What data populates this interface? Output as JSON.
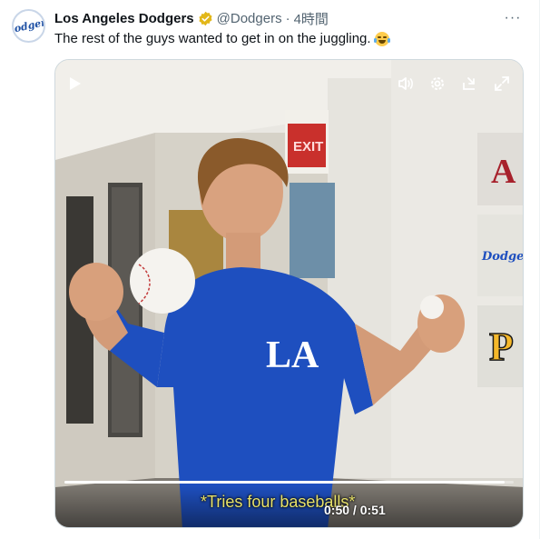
{
  "tweet": {
    "account_name": "Los Angeles Dodgers",
    "handle": "@Dodgers",
    "separator": "·",
    "time": "4時間",
    "more_label": "···",
    "text": "The rest of the guys wanted to get in on the juggling.",
    "emoji": "face-with-tears-of-joy",
    "avatar_text": "Dodgers"
  },
  "video": {
    "subtitle": "*Tries four baseballs*",
    "current_time": "0:50",
    "duration": "0:51",
    "time_separator": " / ",
    "progress_fraction": 0.98,
    "shirt_logo": "LA"
  },
  "wall": {
    "exit_sign": "EXIT",
    "logo_dodgers": "Dodgers",
    "logo_pirates": "P",
    "logo_diamondbacks": "A"
  },
  "colors": {
    "verified": "#e2b719",
    "dodger_blue": "#1e4fbf",
    "subtitle": "#e8e26a"
  }
}
